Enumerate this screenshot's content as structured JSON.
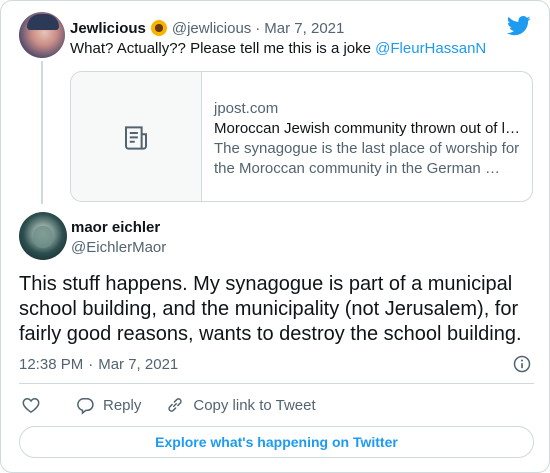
{
  "parent_tweet": {
    "display_name": "Jewlicious",
    "emoji_icon": "sunflower-icon",
    "handle": "@jewlicious",
    "separator": "·",
    "date": "Mar 7, 2021",
    "text": "What? Actually?? Please tell me this is a joke ",
    "mention": "@FleurHassanN"
  },
  "link_card": {
    "domain": "jpost.com",
    "title": "Moroccan Jewish community thrown out of l…",
    "description_line1": "The synagogue is the last place of worship for",
    "description_line2": "the Moroccan community in the German …"
  },
  "main_tweet": {
    "display_name": "maor eichler",
    "handle": "@EichlerMaor",
    "text_lines": [
      "This stuff happens. My synagogue is part of a municipal",
      "school building, and the municipality (not Jerusalem), for",
      "fairly good reasons, wants to destroy the school building."
    ],
    "time": "12:38 PM",
    "separator": "·",
    "date": "Mar 7, 2021"
  },
  "actions": {
    "like_label": "",
    "reply_label": "Reply",
    "copy_link_label": "Copy link to Tweet"
  },
  "explore_label": "Explore what's happening on Twitter",
  "colors": {
    "accent": "#1d9bf0",
    "text": "#0f1419",
    "secondary": "#536471",
    "border": "#cfd9de"
  }
}
